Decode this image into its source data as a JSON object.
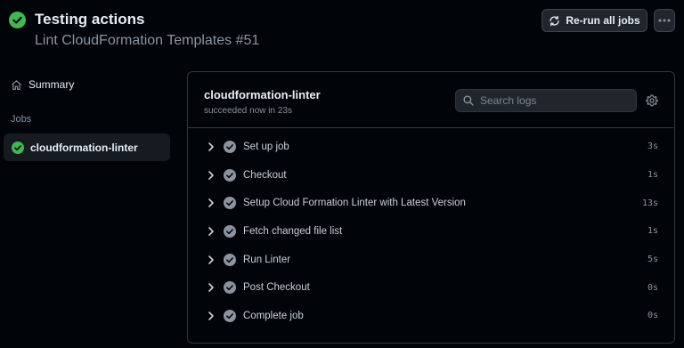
{
  "header": {
    "title": "Testing actions",
    "subtitle": "Lint CloudFormation Templates #51",
    "rerun_label": "Re-run all jobs",
    "more_label": "···"
  },
  "sidebar": {
    "summary_label": "Summary",
    "jobs_heading": "Jobs",
    "jobs": [
      {
        "label": "cloudformation-linter",
        "status": "success"
      }
    ]
  },
  "job": {
    "name": "cloudformation-linter",
    "status_text": "succeeded now in 23s",
    "search_placeholder": "Search logs",
    "steps": [
      {
        "name": "Set up job",
        "duration": "3s"
      },
      {
        "name": "Checkout",
        "duration": "1s"
      },
      {
        "name": "Setup Cloud Formation Linter with Latest Version",
        "duration": "13s"
      },
      {
        "name": "Fetch changed file list",
        "duration": "1s"
      },
      {
        "name": "Run Linter",
        "duration": "5s"
      },
      {
        "name": "Post Checkout",
        "duration": "0s"
      },
      {
        "name": "Complete job",
        "duration": "0s"
      }
    ]
  },
  "colors": {
    "success": "#3fb950",
    "background": "#010409",
    "panel_border": "#30363d",
    "muted_text": "#8b949e"
  }
}
